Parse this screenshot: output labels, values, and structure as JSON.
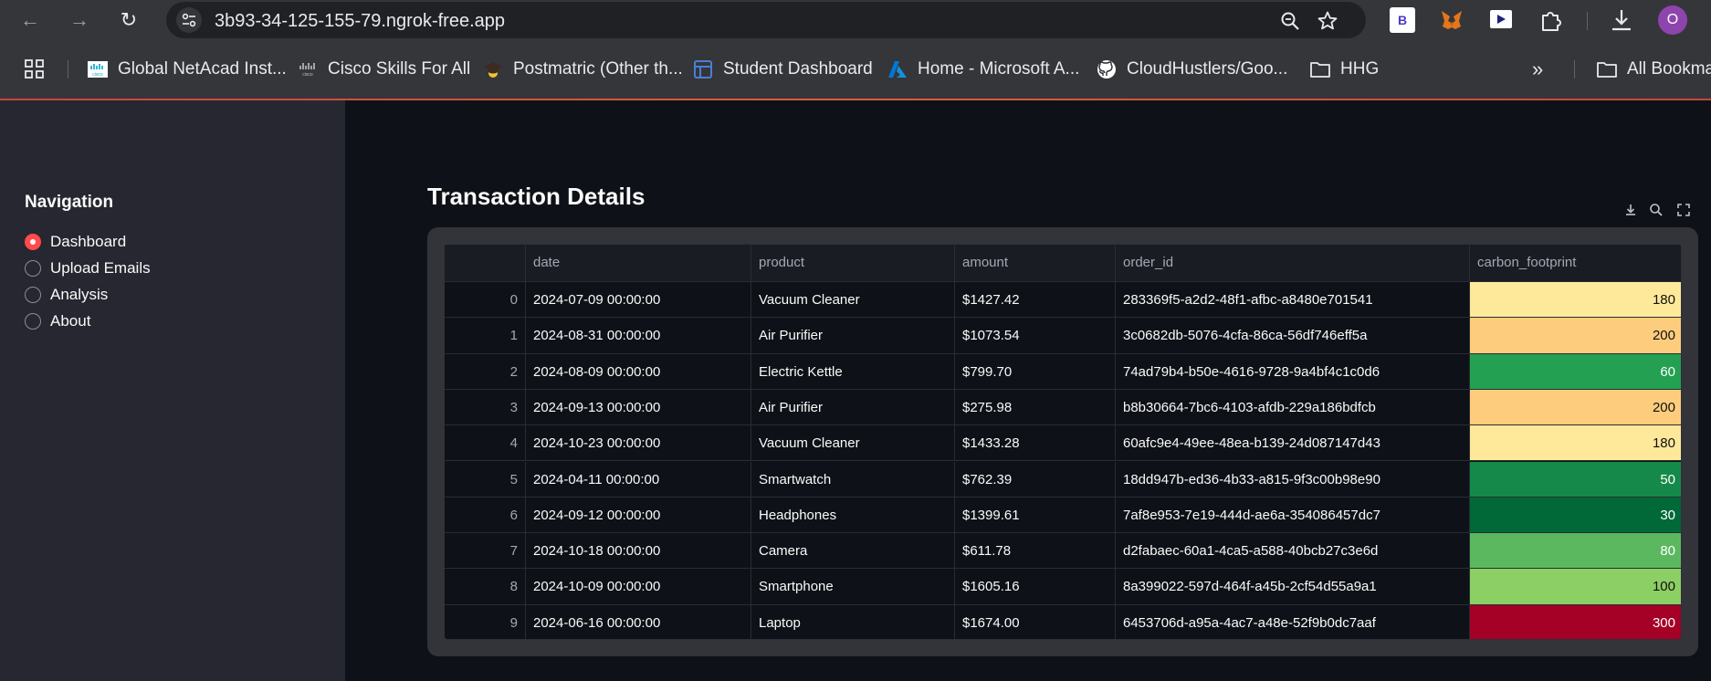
{
  "browser": {
    "url": "3b93-34-125-155-79.ngrok-free.app",
    "profile_initial": "O",
    "extension_b_label": "B",
    "bookmarks": [
      {
        "label": "Global NetAcad Inst...",
        "icon": "cisco-icon"
      },
      {
        "label": "Cisco Skills For All",
        "icon": "cisco-icon"
      },
      {
        "label": "Postmatric (Other th...",
        "icon": "graduation-cap-icon"
      },
      {
        "label": "Student Dashboard",
        "icon": "dashboard-icon"
      },
      {
        "label": "Home - Microsoft A...",
        "icon": "azure-icon"
      },
      {
        "label": "CloudHustlers/Goo...",
        "icon": "github-icon"
      },
      {
        "label": "HHG",
        "icon": "folder-icon"
      }
    ],
    "all_bookmarks_label": "All Bookmarks",
    "overflow_label": "»"
  },
  "sidebar": {
    "title": "Navigation",
    "items": [
      {
        "label": "Dashboard",
        "selected": true
      },
      {
        "label": "Upload Emails",
        "selected": false
      },
      {
        "label": "Analysis",
        "selected": false
      },
      {
        "label": "About",
        "selected": false
      }
    ]
  },
  "main": {
    "title": "Transaction Details",
    "columns": [
      "",
      "date",
      "product",
      "amount",
      "order_id",
      "carbon_footprint"
    ],
    "rows": [
      {
        "idx": "0",
        "date": "2024-07-09 00:00:00",
        "product": "Vacuum Cleaner",
        "amount": "$1427.42",
        "order_id": "283369f5-a2d2-48f1-afbc-a8480e701541",
        "carbon_footprint": "180",
        "cf_color": "#fee99a"
      },
      {
        "idx": "1",
        "date": "2024-08-31 00:00:00",
        "product": "Air Purifier",
        "amount": "$1073.54",
        "order_id": "3c0682db-5076-4cfa-86ca-56df746eff5a",
        "carbon_footprint": "200",
        "cf_color": "#fdcd7d"
      },
      {
        "idx": "2",
        "date": "2024-08-09 00:00:00",
        "product": "Electric Kettle",
        "amount": "$799.70",
        "order_id": "74ad79b4-b50e-4616-9728-9a4bf4c1c0d6",
        "carbon_footprint": "60",
        "cf_color": "#23a052"
      },
      {
        "idx": "3",
        "date": "2024-09-13 00:00:00",
        "product": "Air Purifier",
        "amount": "$275.98",
        "order_id": "b8b30664-7bc6-4103-afdb-229a186bdfcb",
        "carbon_footprint": "200",
        "cf_color": "#fdcd7d"
      },
      {
        "idx": "4",
        "date": "2024-10-23 00:00:00",
        "product": "Vacuum Cleaner",
        "amount": "$1433.28",
        "order_id": "60afc9e4-49ee-48ea-b139-24d087147d43",
        "carbon_footprint": "180",
        "cf_color": "#fee99a"
      },
      {
        "idx": "5",
        "date": "2024-04-11 00:00:00",
        "product": "Smartwatch",
        "amount": "$762.39",
        "order_id": "18dd947b-ed36-4b33-a815-9f3c00b98e90",
        "carbon_footprint": "50",
        "cf_color": "#15894a"
      },
      {
        "idx": "6",
        "date": "2024-09-12 00:00:00",
        "product": "Headphones",
        "amount": "$1399.61",
        "order_id": "7af8e953-7e19-444d-ae6a-354086457dc7",
        "carbon_footprint": "30",
        "cf_color": "#006937"
      },
      {
        "idx": "7",
        "date": "2024-10-18 00:00:00",
        "product": "Camera",
        "amount": "$611.78",
        "order_id": "d2fabaec-60a1-4ca5-a588-40bcb27c3e6d",
        "carbon_footprint": "80",
        "cf_color": "#5cb85f"
      },
      {
        "idx": "8",
        "date": "2024-10-09 00:00:00",
        "product": "Smartphone",
        "amount": "$1605.16",
        "order_id": "8a399022-597d-464f-a45b-2cf54d55a9a1",
        "carbon_footprint": "100",
        "cf_color": "#8ccf64"
      },
      {
        "idx": "9",
        "date": "2024-06-16 00:00:00",
        "product": "Laptop",
        "amount": "$1674.00",
        "order_id": "6453706d-a95a-4ac7-a48e-52f9b0dc7aaf",
        "carbon_footprint": "300",
        "cf_color": "#a50026"
      }
    ]
  },
  "colors": {
    "accent": "#ff4b4b",
    "app_bg": "#0e1117",
    "sidebar_bg": "#262730"
  }
}
